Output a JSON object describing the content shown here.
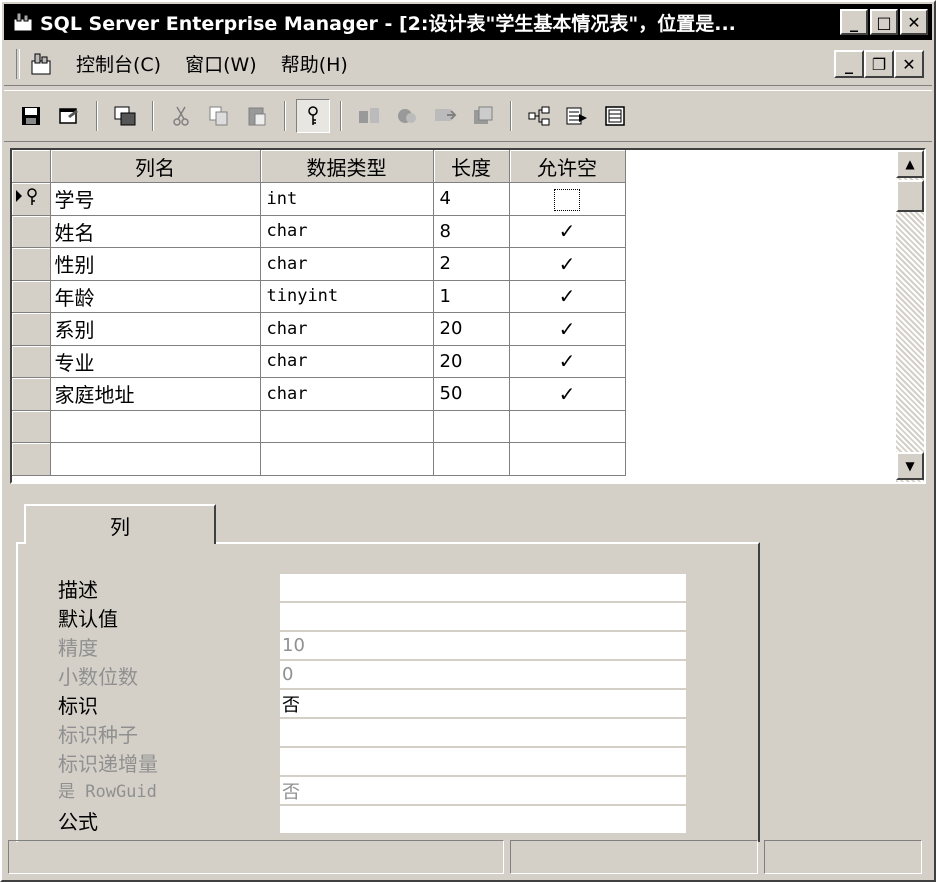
{
  "titlebar": {
    "title": "SQL Server Enterprise Manager - [2:设计表\"学生基本情况表\"，位置是...",
    "min": "_",
    "max": "□",
    "close": "✕"
  },
  "menubar": {
    "items": [
      {
        "label": "控制台(C)"
      },
      {
        "label": "窗口(W)"
      },
      {
        "label": "帮助(H)"
      }
    ],
    "mdi": {
      "min": "_",
      "restore": "❐",
      "close": "✕"
    }
  },
  "toolbar": {
    "icons": [
      "save-icon",
      "properties-icon",
      "manage-indexes-icon",
      "cut-icon",
      "copy-icon",
      "paste-icon",
      "set-primary-key-icon",
      "manage-relationships-icon",
      "manage-triggers-icon",
      "generate-script-icon",
      "table-icon",
      "manage-dependencies-icon",
      "text-view-icon",
      "grid-view-icon"
    ]
  },
  "grid": {
    "headers": {
      "name": "列名",
      "type": "数据类型",
      "length": "长度",
      "nullable": "允许空"
    },
    "rows": [
      {
        "name": "学号",
        "type": "int",
        "length": "4",
        "nullable": false,
        "key": true
      },
      {
        "name": "姓名",
        "type": "char",
        "length": "8",
        "nullable": true
      },
      {
        "name": "性别",
        "type": "char",
        "length": "2",
        "nullable": true
      },
      {
        "name": "年龄",
        "type": "tinyint",
        "length": "1",
        "nullable": true
      },
      {
        "name": "系别",
        "type": "char",
        "length": "20",
        "nullable": true
      },
      {
        "name": "专业",
        "type": "char",
        "length": "20",
        "nullable": true
      },
      {
        "name": "家庭地址",
        "type": "char",
        "length": "50",
        "nullable": true
      }
    ],
    "check_glyph": "✓"
  },
  "columns_tab": {
    "label": "列",
    "properties": [
      {
        "label": "描述",
        "value": "",
        "enabled": true
      },
      {
        "label": "默认值",
        "value": "",
        "enabled": true
      },
      {
        "label": "精度",
        "value": "10",
        "enabled": false
      },
      {
        "label": "小数位数",
        "value": "0",
        "enabled": false
      },
      {
        "label": "标识",
        "value": "否",
        "enabled": true
      },
      {
        "label": "标识种子",
        "value": "",
        "enabled": false
      },
      {
        "label": "标识递增量",
        "value": "",
        "enabled": false
      },
      {
        "label": "是 RowGuid",
        "value": "否",
        "enabled": false
      },
      {
        "label": "公式",
        "value": "",
        "enabled": true
      }
    ]
  }
}
